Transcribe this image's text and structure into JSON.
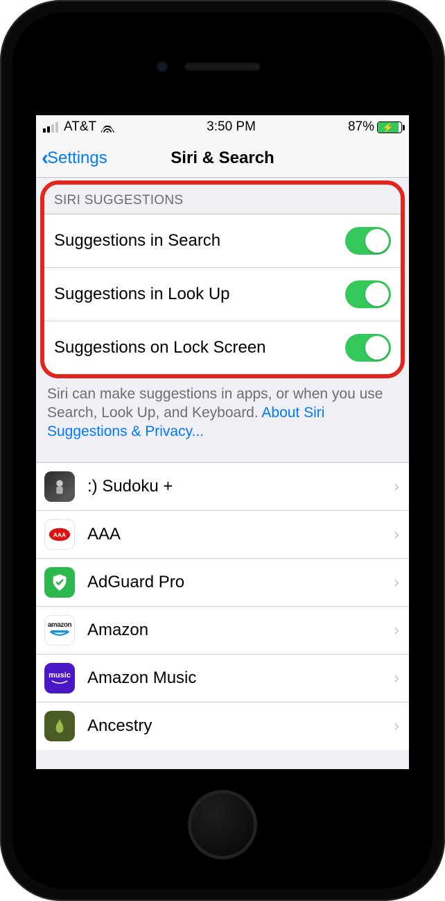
{
  "status": {
    "carrier": "AT&T",
    "time": "3:50 PM",
    "battery_pct": "87%"
  },
  "nav": {
    "back_label": "Settings",
    "title": "Siri & Search"
  },
  "section_header": "SIRI SUGGESTIONS",
  "toggles": [
    {
      "label": "Suggestions in Search",
      "on": true
    },
    {
      "label": "Suggestions in Look Up",
      "on": true
    },
    {
      "label": "Suggestions on Lock Screen",
      "on": true
    }
  ],
  "footer": {
    "text": "Siri can make suggestions in apps, or when you use Search, Look Up, and Keyboard.",
    "link": "About Siri Suggestions & Privacy..."
  },
  "apps": [
    {
      "label": ":) Sudoku +",
      "icon": "sudoku"
    },
    {
      "label": "AAA",
      "icon": "aaa"
    },
    {
      "label": "AdGuard Pro",
      "icon": "adguard"
    },
    {
      "label": "Amazon",
      "icon": "amazon"
    },
    {
      "label": "Amazon Music",
      "icon": "music"
    },
    {
      "label": "Ancestry",
      "icon": "ancestry"
    }
  ],
  "colors": {
    "accent_blue": "#007aff",
    "toggle_green": "#34c759",
    "highlight_red": "#e0261e"
  }
}
